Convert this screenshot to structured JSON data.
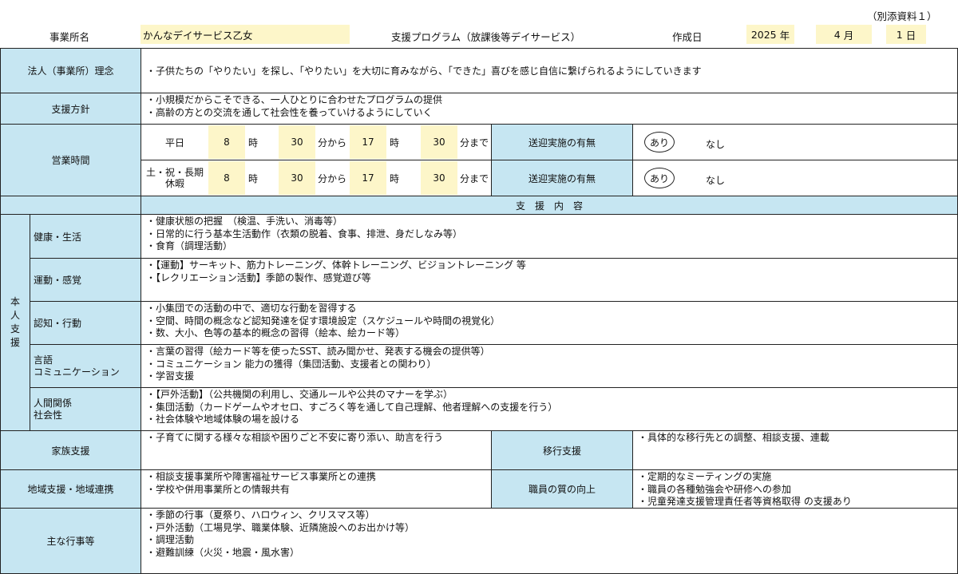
{
  "header": {
    "appendix": "（別添資料１）",
    "office_label": "事業所名",
    "office_name": "かんなデイサービス乙女",
    "program": "支援プログラム（放課後等デイサービス）",
    "created_label": "作成日",
    "year": "2025",
    "year_unit": "年",
    "month": "4",
    "month_unit": "月",
    "day": "1",
    "day_unit": "日"
  },
  "philosophy": {
    "label": "法人（事業所）理念",
    "text": "・子供たちの「やりたい」を探し、「やりたい」を大切に育みながら、「できた」喜びを感じ自信に繋げられるようにしていきます"
  },
  "policy": {
    "label": "支援方針",
    "lines": [
      "・小規模だからこそできる、一人ひとりに合わせたプログラムの提供",
      "・高齢の方との交流を通して社会性を養っていけるようにしていく"
    ]
  },
  "hours": {
    "label": "営業時間",
    "rows": [
      {
        "day_label": "平日",
        "start_hour": "8",
        "hour_unit": "時",
        "start_min": "30",
        "from_unit": "分から",
        "end_hour": "17",
        "hour_unit2": "時",
        "end_min": "30",
        "until_unit": "分まで",
        "transport_label": "送迎実施の有無",
        "yes": "あり",
        "no": "なし"
      },
      {
        "day_label": "土・祝・長期\n休暇",
        "start_hour": "8",
        "hour_unit": "時",
        "start_min": "30",
        "from_unit": "分から",
        "end_hour": "17",
        "hour_unit2": "時",
        "end_min": "30",
        "until_unit": "分まで",
        "transport_label": "送迎実施の有無",
        "yes": "あり",
        "no": "なし"
      }
    ]
  },
  "support_header": "支　援　内　容",
  "personal": {
    "label": "本人支援",
    "label_chars": [
      "本",
      "人",
      "支",
      "援"
    ],
    "categories": [
      {
        "label": "健康・生活",
        "lines": [
          "・健康状態の把握　（検温、手洗い、消毒等）",
          "・日常的に行う基本生活動作（衣類の脱着、食事、排泄、身だしなみ等）",
          "・食育（調理活動）"
        ]
      },
      {
        "label": "運動・感覚",
        "lines": [
          "・【運動】サーキット、筋力トレーニング、体幹トレーニング、ビジョントレーニング 等",
          "・【レクリエーション活動】季節の製作、感覚遊び等"
        ]
      },
      {
        "label": "認知・行動",
        "lines": [
          "・小集団での活動の中で、適切な行動を習得する",
          "・空間、時間の概念など認知発達を促す環境設定（スケジュールや時間の視覚化）",
          "・数、大小、色等の基本的概念の習得（絵本、絵カード等）"
        ]
      },
      {
        "label": "言語\nコミュニケーション",
        "lines": [
          "・言葉の習得（絵カード等を使ったSST、読み聞かせ、発表する機会の提供等）",
          "・コミュニケーション 能力の獲得（集団活動、支援者との関わり）",
          "・学習支援"
        ]
      },
      {
        "label": "人間関係\n社会性",
        "lines": [
          "・【戸外活動】（公共機関の利用し、交通ルールや公共のマナーを学ぶ）",
          "・集団活動（カードゲームやオセロ、すごろく等を通して自己理解、他者理解への支援を行う）",
          "・社会体験や地域体験の場を設ける"
        ]
      }
    ]
  },
  "family": {
    "label": "家族支援",
    "lines": [
      "・子育てに関する様々な相談や困りごと不安に寄り添い、助言を行う"
    ]
  },
  "transition": {
    "label": "移行支援",
    "lines": [
      "・具体的な移行先との調整、相談支援、連載"
    ]
  },
  "community": {
    "label": "地域支援・地域連携",
    "lines": [
      "・相談支援事業所や障害福祉サービス事業所との連携",
      "・学校や併用事業所との情報共有"
    ]
  },
  "staff": {
    "label": "職員の質の向上",
    "lines": [
      "・定期的なミーティングの実施",
      "・職員の各種勉強会や研修への参加",
      "・児童発達支援管理責任者等資格取得 の支援あり"
    ]
  },
  "events": {
    "label": "主な行事等",
    "lines": [
      "・季節の行事（夏祭り、ハロウィン、クリスマス等）",
      "・戸外活動（工場見学、職業体験、近隣施設へのお出かけ等）",
      "・調理活動",
      "・避難訓練（火災・地震・風水害）"
    ]
  },
  "colors": {
    "label_bg": "#c6e6f2",
    "input_bg": "#fdf6c9",
    "border": "#222222"
  }
}
